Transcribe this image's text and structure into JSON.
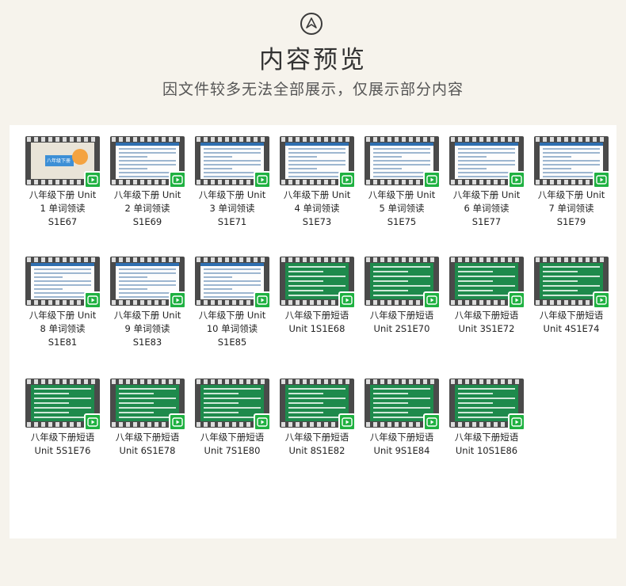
{
  "header": {
    "title": "内容预览",
    "subtitle": "因文件较多无法全部展示，仅展示部分内容",
    "logo_icon": "up-arrow-circle-icon"
  },
  "items": [
    {
      "line1": "八年级下册 Unit",
      "line2": "1 单词领读",
      "line3": "S1E67",
      "style": "cover"
    },
    {
      "line1": "八年级下册 Unit",
      "line2": "2 单词领读",
      "line3": "S1E69",
      "style": "white"
    },
    {
      "line1": "八年级下册 Unit",
      "line2": "3 单词领读",
      "line3": "S1E71",
      "style": "white"
    },
    {
      "line1": "八年级下册 Unit",
      "line2": "4 单词领读",
      "line3": "S1E73",
      "style": "white"
    },
    {
      "line1": "八年级下册 Unit",
      "line2": "5 单词领读",
      "line3": "S1E75",
      "style": "white"
    },
    {
      "line1": "八年级下册 Unit",
      "line2": "6 单词领读",
      "line3": "S1E77",
      "style": "white"
    },
    {
      "line1": "八年级下册 Unit",
      "line2": "7 单词领读",
      "line3": "S1E79",
      "style": "white"
    },
    {
      "line1": "八年级下册 Unit",
      "line2": "8 单词领读",
      "line3": "S1E81",
      "style": "white"
    },
    {
      "line1": "八年级下册 Unit",
      "line2": "9 单词领读",
      "line3": "S1E83",
      "style": "white"
    },
    {
      "line1": "八年级下册 Unit",
      "line2": "10 单词领读",
      "line3": "S1E85",
      "style": "white"
    },
    {
      "line1": "八年级下册短语",
      "line2": "Unit 1S1E68",
      "line3": "",
      "style": "green"
    },
    {
      "line1": "八年级下册短语",
      "line2": "Unit 2S1E70",
      "line3": "",
      "style": "green"
    },
    {
      "line1": "八年级下册短语",
      "line2": "Unit 3S1E72",
      "line3": "",
      "style": "green"
    },
    {
      "line1": "八年级下册短语",
      "line2": "Unit 4S1E74",
      "line3": "",
      "style": "green"
    },
    {
      "line1": "八年级下册短语",
      "line2": "Unit 5S1E76",
      "line3": "",
      "style": "green"
    },
    {
      "line1": "八年级下册短语",
      "line2": "Unit 6S1E78",
      "line3": "",
      "style": "green"
    },
    {
      "line1": "八年级下册短语",
      "line2": "Unit 7S1E80",
      "line3": "",
      "style": "green"
    },
    {
      "line1": "八年级下册短语",
      "line2": "Unit 8S1E82",
      "line3": "",
      "style": "green"
    },
    {
      "line1": "八年级下册短语",
      "line2": "Unit 9S1E84",
      "line3": "",
      "style": "green"
    },
    {
      "line1": "八年级下册短语",
      "line2": "Unit 10S1E86",
      "line3": "",
      "style": "green"
    }
  ],
  "cover_label": "八年级下册",
  "play_icon": "video-play-icon"
}
